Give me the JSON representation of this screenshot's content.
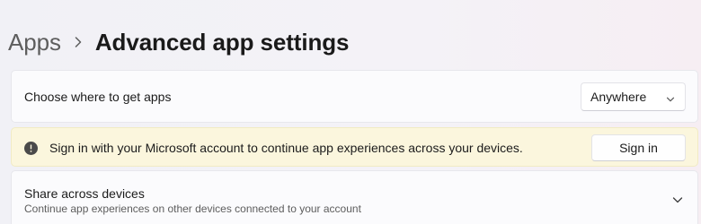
{
  "breadcrumb": {
    "parent": "Apps",
    "current": "Advanced app settings"
  },
  "apps_source": {
    "label": "Choose where to get apps",
    "selected": "Anywhere"
  },
  "signin_banner": {
    "message": "Sign in with your Microsoft account to continue app experiences across your devices.",
    "button_label": "Sign in"
  },
  "share": {
    "title": "Share across devices",
    "subtitle": "Continue app experiences on other devices connected to your account"
  },
  "icons": {
    "separator": "chevron-right-icon",
    "dropdown": "chevron-down-icon",
    "banner": "info-icon",
    "expand": "chevron-down-icon"
  },
  "colors": {
    "banner_background": "#fbf6dd",
    "card_background": "#fbfbfd",
    "info_icon": "#4a4a4a"
  }
}
